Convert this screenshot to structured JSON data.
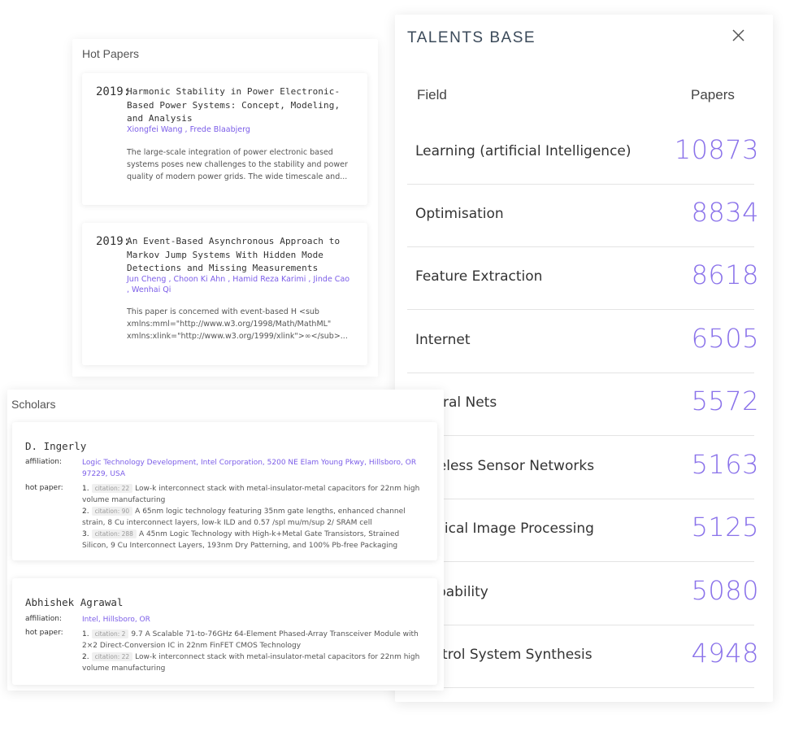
{
  "hot_papers": {
    "title": "Hot Papers",
    "papers": [
      {
        "year": "2019:",
        "title": "Harmonic Stability in Power Electronic-Based Power Systems: Concept, Modeling, and Analysis",
        "authors": [
          "Xiongfei Wang",
          "Frede Blaabjerg"
        ],
        "abstract": "The large-scale integration of power electronic based systems poses new challenges to the stability and power quality of modern power grids. The wide timescale and..."
      },
      {
        "year": "2019:",
        "title": "An Event-Based Asynchronous Approach to Markov Jump Systems With Hidden Mode Detections and Missing Measurements",
        "authors": [
          "Jun Cheng",
          "Choon Ki Ahn",
          "Hamid Reza Karimi",
          "Jinde Cao",
          "Wenhai Qi"
        ],
        "abstract": "This paper is concerned with event-based H <sub xmlns:mml=\"http://www.w3.org/1998/Math/MathML\" xmlns:xlink=\"http://www.w3.org/1999/xlink\">∞</sub>..."
      }
    ]
  },
  "talents": {
    "title": "TALENTS BASE",
    "col_field": "Field",
    "col_papers": "Papers",
    "accent_color": "#8a72ea",
    "rows": [
      {
        "field": "Learning (artificial Intelligence)",
        "papers": "10873"
      },
      {
        "field": "Optimisation",
        "papers": "8834"
      },
      {
        "field": "Feature Extraction",
        "papers": "8618"
      },
      {
        "field": "Internet",
        "papers": "6505"
      },
      {
        "field": "Neural Nets",
        "papers": "5572"
      },
      {
        "field": "Wireless Sensor Networks",
        "papers": "5163"
      },
      {
        "field": "Medical Image Processing",
        "papers": "5125"
      },
      {
        "field": "Probability",
        "papers": "5080"
      },
      {
        "field": "Control System Synthesis",
        "papers": "4948"
      }
    ]
  },
  "scholars": {
    "title": "Scholars",
    "affiliation_label": "affiliation:",
    "hot_paper_label": "hot paper:",
    "citation_prefix": "citation:",
    "people": [
      {
        "name": "D. Ingerly",
        "affiliation": "Logic Technology Development, Intel Corporation, 5200 NE Elam Young Pkwy, Hillsboro, OR 97229, USA",
        "papers": [
          {
            "num": "1.",
            "citation": "citation: 22",
            "title": "Low-k interconnect stack with metal-insulator-metal capacitors for 22nm high volume manufacturing"
          },
          {
            "num": "2.",
            "citation": "citation: 90",
            "title": "A 65nm logic technology featuring 35nm gate lengths, enhanced channel strain, 8 Cu interconnect layers, low-k ILD and 0.57 /spl mu/m/sup 2/ SRAM cell"
          },
          {
            "num": "3.",
            "citation": "citation: 288",
            "title": "A 45nm Logic Technology with High-k+Metal Gate Transistors, Strained Silicon, 9 Cu Interconnect Layers, 193nm Dry Patterning, and 100% Pb-free Packaging"
          }
        ]
      },
      {
        "name": "Abhishek Agrawal",
        "affiliation": "Intel, Hillsboro, OR",
        "papers": [
          {
            "num": "1.",
            "citation": "citation: 2",
            "title": "9.7 A Scalable 71-to-76GHz 64-Element Phased-Array Transceiver Module with 2×2 Direct-Conversion IC in 22nm FinFET CMOS Technology"
          },
          {
            "num": "2.",
            "citation": "citation: 22",
            "title": "Low-k interconnect stack with metal-insulator-metal capacitors for 22nm high volume manufacturing"
          }
        ]
      }
    ]
  }
}
